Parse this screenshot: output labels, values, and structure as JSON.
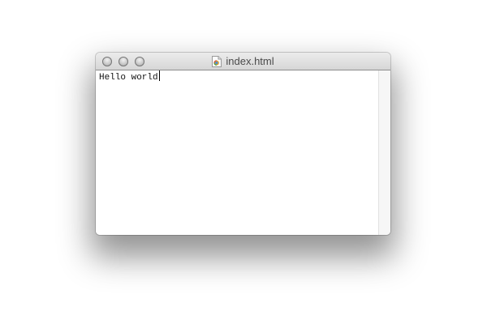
{
  "window": {
    "title": "index.html",
    "file_icon": "html-document-icon"
  },
  "editor": {
    "text": "Hello world"
  }
}
